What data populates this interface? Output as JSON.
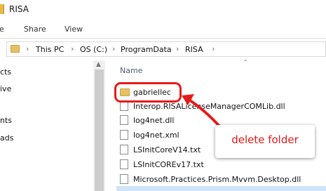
{
  "window": {
    "title": "RISA"
  },
  "ribbon": {
    "tabs": [
      "e",
      "Share",
      "View"
    ]
  },
  "address_bar": {
    "crumbs": [
      "This PC",
      "OS (C:)",
      "ProgramData",
      "RISA"
    ]
  },
  "nav_pane": {
    "items": [
      "cts",
      "ive",
      "nts",
      "ads"
    ]
  },
  "content": {
    "column_header": "Name",
    "rows": [
      {
        "name": "gabriellec",
        "icon": "folder-icon"
      },
      {
        "name": "Interop.RISALicenseManagerCOMLib.dll",
        "icon": "dll-file-icon"
      },
      {
        "name": "log4net.dll",
        "icon": "dll-file-icon"
      },
      {
        "name": "log4net.xml",
        "icon": "xml-file-icon"
      },
      {
        "name": "LSInitCoreV14.txt",
        "icon": "text-file-icon"
      },
      {
        "name": "LSInitCOREv17.txt",
        "icon": "text-file-icon"
      },
      {
        "name": "Microsoft.Practices.Prism.Mvvm.Desktop.dll",
        "icon": "dll-file-icon"
      }
    ]
  },
  "annotation": {
    "label": "delete folder",
    "color": "#e01818"
  }
}
